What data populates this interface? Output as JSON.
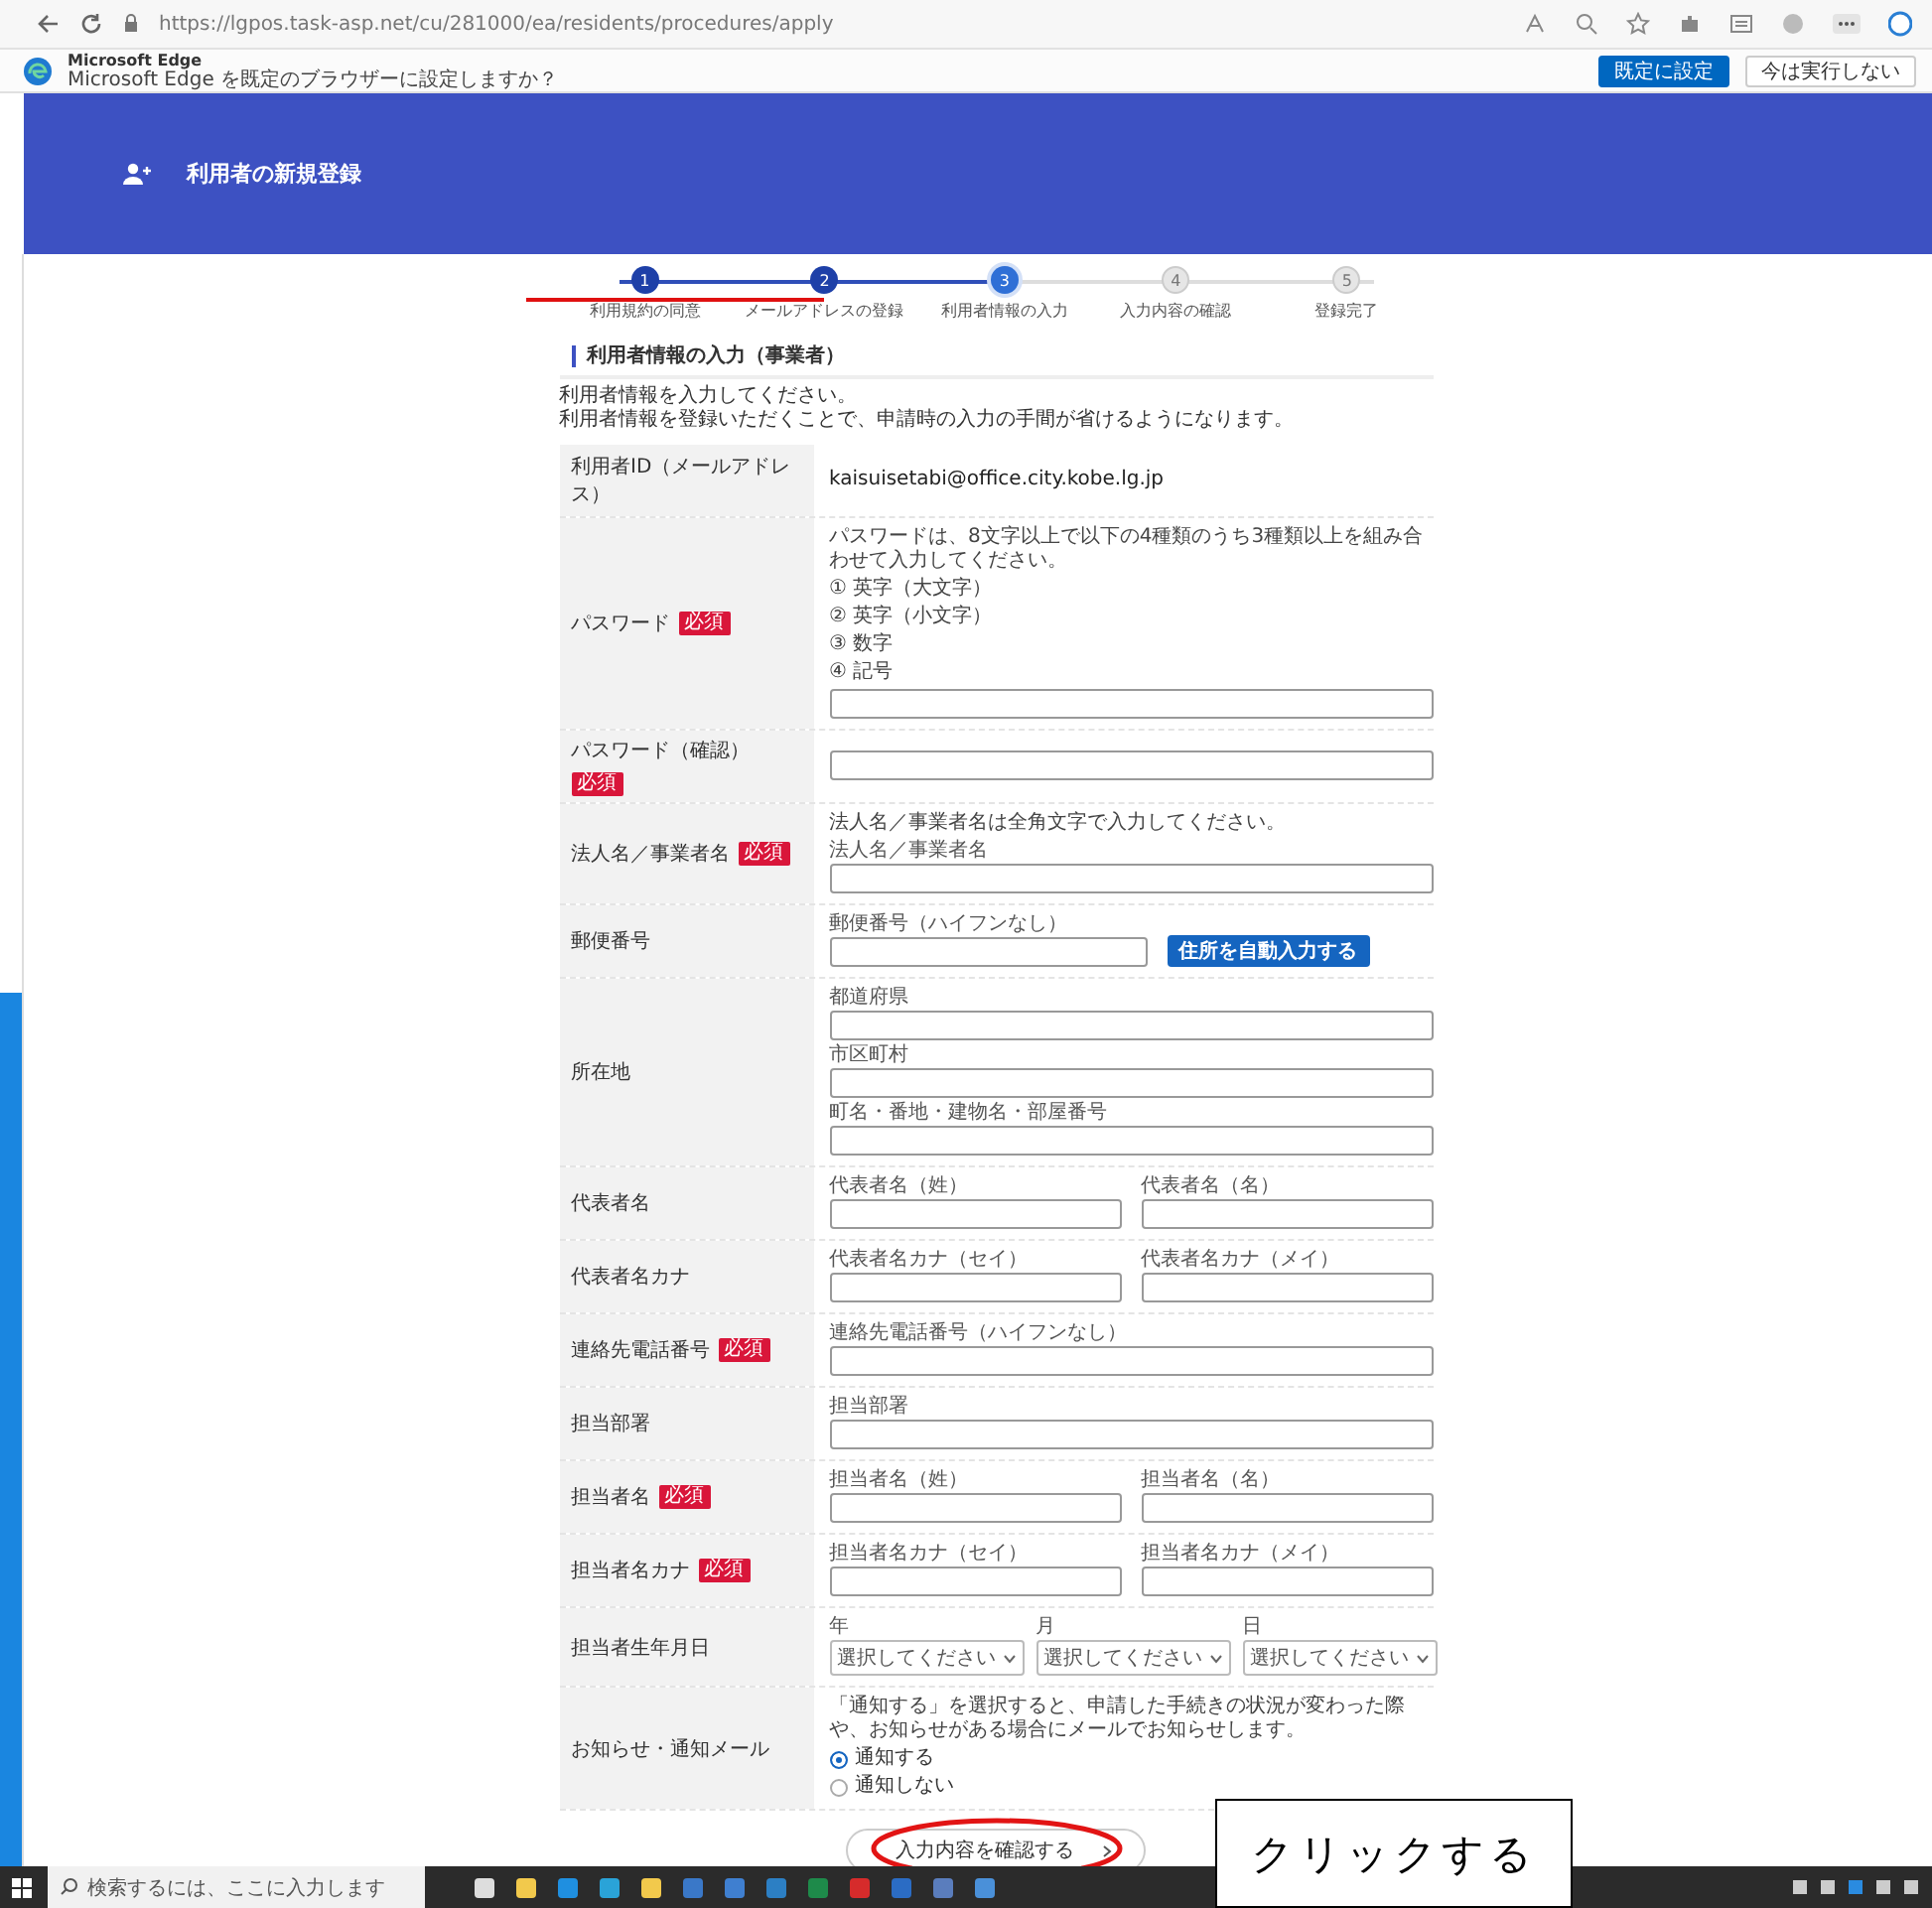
{
  "browser": {
    "url": "https://lgpos.task-asp.net/cu/281000/ea/residents/procedures/apply",
    "infobar": {
      "title": "Microsoft Edge",
      "message": "Microsoft Edge を既定のブラウザーに設定しますか？",
      "buttons": [
        {
          "label": "既定に設定",
          "kind": "primary"
        },
        {
          "label": "今は実行しない",
          "kind": "secondary"
        }
      ]
    }
  },
  "header": {
    "title": "利用者の新規登録"
  },
  "steps": [
    {
      "number": "1",
      "label": "利用規約の同意",
      "completed": true,
      "selected": false
    },
    {
      "number": "2",
      "label": "メールアドレスの登録",
      "completed": true,
      "selected": false
    },
    {
      "number": "3",
      "label": "利用者情報の入力",
      "completed": false,
      "selected": true
    },
    {
      "number": "4",
      "label": "入力内容の確認",
      "completed": false,
      "selected": false
    },
    {
      "number": "5",
      "label": "登録完了",
      "completed": false,
      "selected": false
    }
  ],
  "section_title": "利用者情報の入力（事業者）",
  "intro": [
    "利用者情報を入力してください。",
    "利用者情報を登録いただくことで、申請時の入力の手間が省けるようになります。"
  ],
  "fields": [
    {
      "label": "利用者ID（メールアドレス）",
      "kind": "static",
      "value": "kaisuisetabi@office.city.kobe.lg.jp"
    },
    {
      "label": "パスワード",
      "badge": "必須",
      "kind": "form",
      "hint": [
        "パスワードは、8文字以上で以下の4種類のうち3種類以上を組み合わせて入力してください。",
        "① 英字（大文字）",
        "② 英字（小文字）",
        "③ 数字",
        "④ 記号"
      ],
      "rows": [
        [
          {
            "kind": "input"
          }
        ]
      ]
    },
    {
      "label": "パスワード（確認）",
      "badge": "必須",
      "kind": "form",
      "rows": [
        [
          {
            "kind": "input"
          }
        ]
      ]
    },
    {
      "label": "法人名／事業者名",
      "badge": "必須",
      "kind": "form",
      "hint": [
        "法人名／事業者名は全角文字で入力してください。"
      ],
      "rows": [
        [
          {
            "kind": "input",
            "caption": "法人名／事業者名"
          }
        ]
      ]
    },
    {
      "label": "郵便番号",
      "kind": "form",
      "rows": [
        [
          {
            "kind": "input",
            "caption": "郵便番号（ハイフンなし）"
          },
          {
            "kind": "button",
            "label": "住所を自動入力する"
          }
        ]
      ]
    },
    {
      "label": "所在地",
      "kind": "form",
      "rows": [
        [
          {
            "kind": "input",
            "caption": "都道府県"
          }
        ],
        [
          {
            "kind": "input",
            "caption": "市区町村"
          }
        ],
        [
          {
            "kind": "input",
            "caption": "町名・番地・建物名・部屋番号"
          }
        ]
      ]
    },
    {
      "label": "代表者名",
      "kind": "form",
      "rows": [
        [
          {
            "kind": "input",
            "caption": "代表者名（姓）"
          },
          {
            "kind": "input",
            "caption": "代表者名（名）"
          }
        ]
      ]
    },
    {
      "label": "代表者名カナ",
      "kind": "form",
      "rows": [
        [
          {
            "kind": "input",
            "caption": "代表者名カナ（セイ）"
          },
          {
            "kind": "input",
            "caption": "代表者名カナ（メイ）"
          }
        ]
      ]
    },
    {
      "label": "連絡先電話番号",
      "badge": "必須",
      "kind": "form",
      "rows": [
        [
          {
            "kind": "input",
            "caption": "連絡先電話番号（ハイフンなし）"
          }
        ]
      ]
    },
    {
      "label": "担当部署",
      "kind": "form",
      "rows": [
        [
          {
            "kind": "input",
            "caption": "担当部署"
          }
        ]
      ]
    },
    {
      "label": "担当者名",
      "badge": "必須",
      "kind": "form",
      "rows": [
        [
          {
            "kind": "input",
            "caption": "担当者名（姓）"
          },
          {
            "kind": "input",
            "caption": "担当者名（名）"
          }
        ]
      ]
    },
    {
      "label": "担当者名カナ",
      "badge": "必須",
      "kind": "form",
      "rows": [
        [
          {
            "kind": "input",
            "caption": "担当者名カナ（セイ）"
          },
          {
            "kind": "input",
            "caption": "担当者名カナ（メイ）"
          }
        ]
      ]
    },
    {
      "label": "担当者生年月日",
      "kind": "form",
      "rows": [
        [
          {
            "kind": "select",
            "caption": "年",
            "value": "選択してください"
          },
          {
            "kind": "select",
            "caption": "月",
            "value": "選択してください"
          },
          {
            "kind": "select",
            "caption": "日",
            "value": "選択してください"
          }
        ]
      ]
    },
    {
      "label": "お知らせ・通知メール",
      "kind": "form",
      "hint": [
        "「通知する」を選択すると、申請した手続きの状況が変わった際や、お知らせがある場合にメールでお知らせします。"
      ],
      "rows": [
        [
          {
            "kind": "radio",
            "label": "通知する",
            "selected": true
          }
        ],
        [
          {
            "kind": "radio",
            "label": "通知しない",
            "selected": false
          }
        ]
      ]
    }
  ],
  "submit": {
    "label": "入力内容を確認する"
  },
  "callout": {
    "text": "クリックする"
  },
  "taskbar": {
    "search_placeholder": "検索するには、ここに入力します"
  }
}
